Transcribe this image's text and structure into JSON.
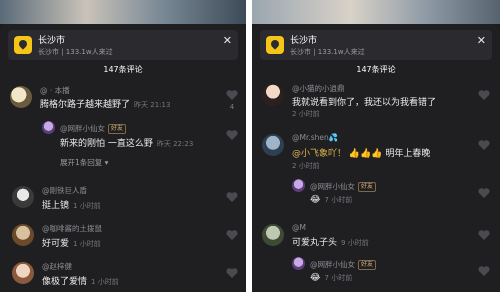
{
  "left": {
    "location": {
      "title": "长沙市",
      "subtitle": "长沙市 | 133.1w人来过"
    },
    "comment_count": "147条评论",
    "comments": [
      {
        "user": "@ · 本播",
        "text": "腾格尔路子越来越野了",
        "time": "昨天 21:13",
        "likes": "4"
      },
      {
        "user": "@网胖小仙女",
        "badge": "好友",
        "text": "新来的刚怕 一直这么野",
        "time": "昨天 22:23"
      },
      {
        "expand": "展开1条回复"
      },
      {
        "user": "@刚铁巨人盾",
        "text": "挺上镜",
        "time": "1 小时前"
      },
      {
        "user": "@咖啡酱的土拨鼠",
        "text": "好可爱",
        "time": "1 小时前"
      },
      {
        "user": "@赵梓健",
        "text": "像极了爱情",
        "time": "1 小时前"
      }
    ]
  },
  "right": {
    "location": {
      "title": "长沙市",
      "subtitle": "长沙市 | 133.1w人来过"
    },
    "comment_count": "147条评论",
    "comments": [
      {
        "user": "@小猫的小逍鼎",
        "text": "我就说看到你了，我还以为我看错了",
        "time": "2 小时前"
      },
      {
        "user": "@Mr.shen💦",
        "mention": "@小飞象吖！",
        "text": "👍👍👍 明年上春晚",
        "time": "2 小时前"
      },
      {
        "user": "@网胖小仙女",
        "badge": "好友",
        "text": "😂",
        "time": "7 小时前"
      },
      {
        "user": "@M",
        "text": "可爱丸子头",
        "time": "9 小时前"
      },
      {
        "user": "@网胖小仙女",
        "badge": "好友",
        "text": "😂",
        "time": "7 小时前"
      }
    ]
  },
  "colors": {
    "sheet": "#1f1f22",
    "accent_yellow": "#f5c518",
    "mention": "#e0b74f"
  },
  "icons": {
    "location": "location-pin-icon",
    "close": "close-icon",
    "like": "heart-icon",
    "expand": "chevron-down-icon"
  }
}
